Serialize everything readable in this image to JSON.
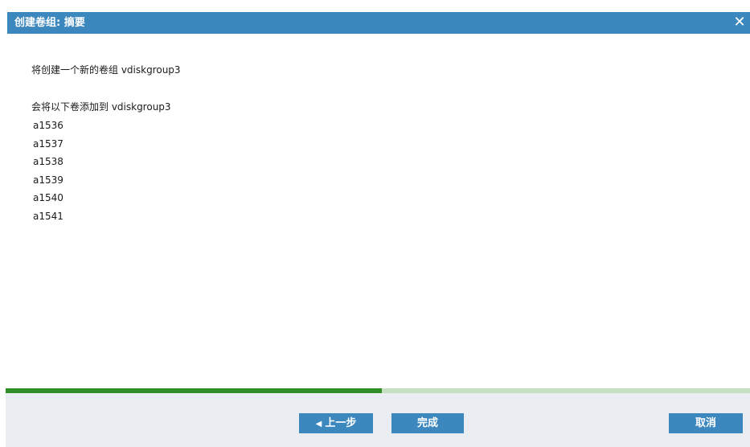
{
  "dialog": {
    "title": "创建卷组: 摘要",
    "close_glyph": "✕"
  },
  "summary": {
    "create_line": "将创建一个新的卷组 vdiskgroup3",
    "add_line": "会将以下卷添加到 vdiskgroup3",
    "volumes": [
      "a1536",
      "a1537",
      "a1538",
      "a1539",
      "a1540",
      "a1541"
    ]
  },
  "progress": {
    "fraction": 0.505
  },
  "buttons": {
    "prev_icon": "◀",
    "prev_label": "上一步",
    "finish_label": "完成",
    "cancel_label": "取消"
  },
  "colors": {
    "titlebar": "#3d87bf",
    "button": "#3d87bf",
    "progress_fill": "#2f8e25",
    "progress_track": "#c6dfc3",
    "footer": "#eaedf1"
  }
}
